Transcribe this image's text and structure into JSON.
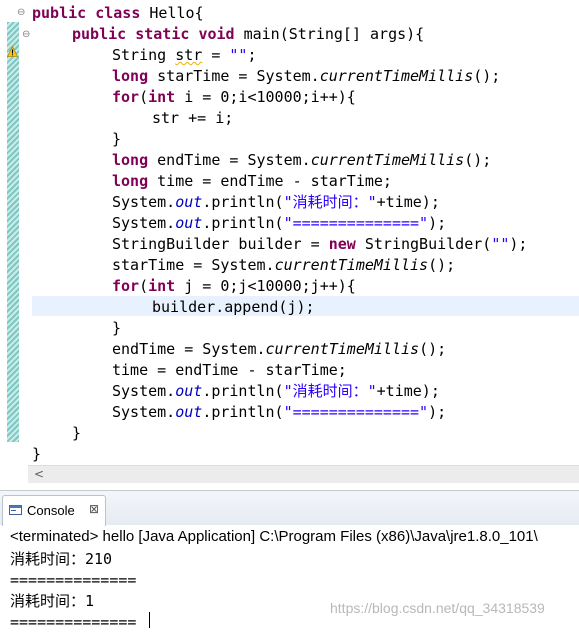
{
  "editor": {
    "code_lines": [
      {
        "text": "public class Hello{"
      },
      {
        "text": "public static void main(String[] args){"
      },
      {
        "text": "String str = \"\";"
      },
      {
        "text": "long starTime = System.currentTimeMillis();"
      },
      {
        "text": "for(int i = 0;i<10000;i++){"
      },
      {
        "text": "str += i;"
      },
      {
        "text": "}"
      },
      {
        "text": "long endTime = System.currentTimeMillis();"
      },
      {
        "text": "long time = endTime - starTime;"
      },
      {
        "text": "System.out.println(\"消耗时间：\"+time);"
      },
      {
        "text": "System.out.println(\"==============\");"
      },
      {
        "text": "StringBuilder builder = new StringBuilder(\"\");"
      },
      {
        "text": "starTime = System.currentTimeMillis();"
      },
      {
        "text": "for(int j = 0;j<10000;j++){"
      },
      {
        "text": "builder.append(j);"
      },
      {
        "text": "}"
      },
      {
        "text": "endTime = System.currentTimeMillis();"
      },
      {
        "text": "time = endTime - starTime;"
      },
      {
        "text": "System.out.println(\"消耗时间：\"+time);"
      },
      {
        "text": "System.out.println(\"==============\");"
      },
      {
        "text": "}"
      },
      {
        "text": "}"
      }
    ],
    "tokens": {
      "public": "public",
      "class": "class",
      "static": "static",
      "void": "void",
      "long": "long",
      "for": "for",
      "int": "int",
      "new": "new",
      "out": "out",
      "currentTimeMillis": "currentTimeMillis",
      "empty_str": "\"\"",
      "time_label": "\"消耗时间：\"",
      "separator": "\"==============\""
    },
    "icons": {
      "fold": "fold-collapse-icon",
      "warning": "warning-icon"
    }
  },
  "scrollbar": {
    "left_arrow": "<"
  },
  "console": {
    "tab_label": "Console",
    "close_glyph": "⊠",
    "terminated_text": "<terminated> hello [Java Application] C:\\Program Files (x86)\\Java\\jre1.8.0_101\\",
    "output_lines": [
      "消耗时间：210",
      "==============",
      "消耗时间：1",
      "=============="
    ]
  },
  "watermark": "https://blog.csdn.net/qq_34318539",
  "colors": {
    "keyword": "#7f0055",
    "string": "#2a00ff",
    "field": "#0000c0",
    "current_line": "#e8f2fe"
  }
}
